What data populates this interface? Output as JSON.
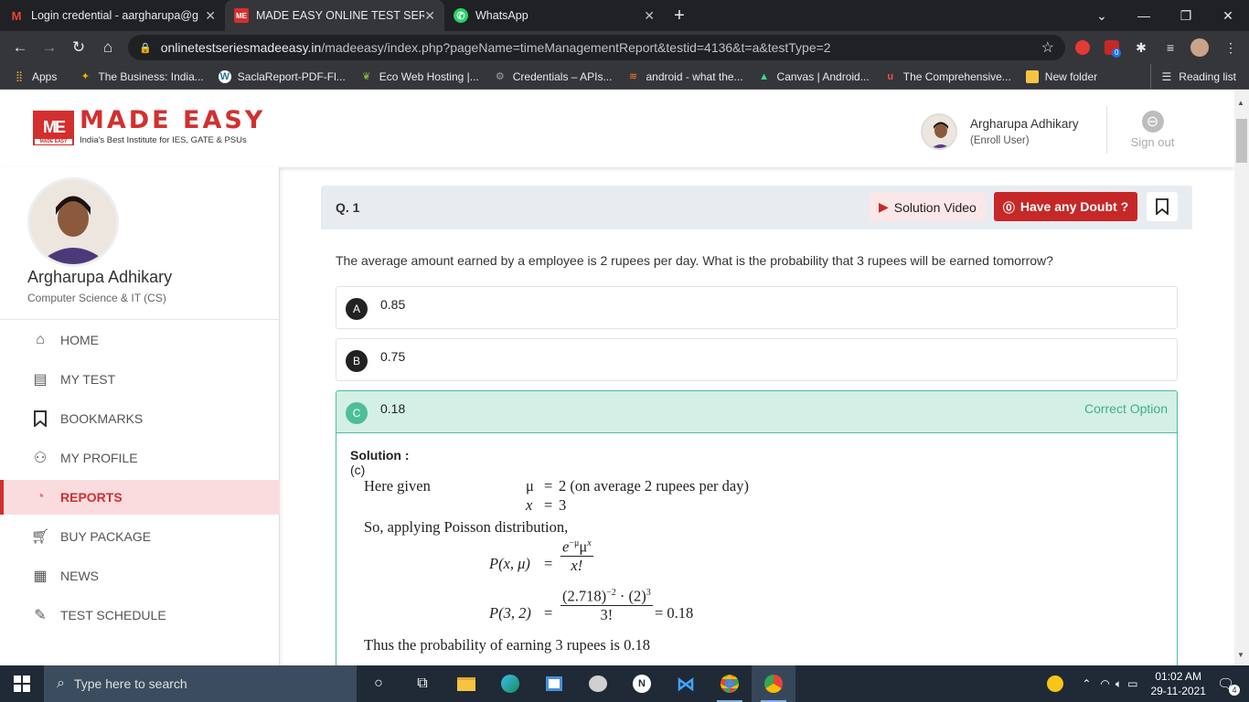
{
  "browser": {
    "tabs": [
      {
        "title": "Login credential - aargharupa@g",
        "icon": "gmail-icon"
      },
      {
        "title": "MADE EASY ONLINE TEST SERIES",
        "icon": "madeeasy-icon"
      },
      {
        "title": "WhatsApp",
        "icon": "whatsapp-icon"
      }
    ],
    "url_host": "onlinetestseriesmadeeasy.in",
    "url_path": "/madeeasy/index.php?pageName=timeManagementReport&testid=4136&t=a&testType=2",
    "ext_badge": "0",
    "bookmarks": [
      {
        "label": "Apps"
      },
      {
        "label": "The Business: India..."
      },
      {
        "label": "SaclaReport-PDF-Fl..."
      },
      {
        "label": "Eco Web Hosting |..."
      },
      {
        "label": "Credentials – APIs..."
      },
      {
        "label": "android - what the..."
      },
      {
        "label": "Canvas | Android..."
      },
      {
        "label": "The Comprehensive..."
      },
      {
        "label": "New folder"
      }
    ],
    "reading_list": "Reading list"
  },
  "header": {
    "logo_text": "MADE EASY",
    "logo_tagline": "India's Best Institute for IES, GATE & PSUs",
    "logo_box_sub": "MADE EASY",
    "user_name": "Argharupa Adhikary",
    "user_role": "(Enroll User)",
    "signout": "Sign out"
  },
  "sidebar": {
    "name": "Argharupa Adhikary",
    "dept": "Computer Science & IT (CS)",
    "items": [
      {
        "label": "HOME",
        "icon": "home-icon"
      },
      {
        "label": "MY TEST",
        "icon": "test-icon"
      },
      {
        "label": "BOOKMARKS",
        "icon": "bookmark-icon"
      },
      {
        "label": "MY PROFILE",
        "icon": "profile-icon"
      },
      {
        "label": "REPORTS",
        "icon": "reports-icon"
      },
      {
        "label": "BUY PACKAGE",
        "icon": "cart-icon"
      },
      {
        "label": "NEWS",
        "icon": "news-icon"
      },
      {
        "label": "TEST SCHEDULE",
        "icon": "schedule-icon"
      }
    ]
  },
  "question": {
    "number": "Q. 1",
    "solution_video": "Solution Video",
    "have_doubt": "Have any Doubt ?",
    "text": "The average amount earned by a employee is 2 rupees per day. What is the probability that 3 rupees will be earned tomorrow?",
    "options": [
      {
        "letter": "A",
        "value": "0.85"
      },
      {
        "letter": "B",
        "value": "0.75"
      },
      {
        "letter": "C",
        "value": "0.18"
      }
    ],
    "correct_label": "Correct Option",
    "solution_title": "Solution :",
    "solution_answer": "(c)",
    "sol_given": "Here given",
    "sol_mu": "μ",
    "sol_eq": "=",
    "sol_mu_val": "2 (on average 2 rupees per day)",
    "sol_x": "x",
    "sol_x_val": "3",
    "sol_applying": "So, applying Poisson distribution,",
    "sol_p1_lhs": "P(x, μ)",
    "sol_p1_num": "e",
    "sol_p1_num_sup": "−μ",
    "sol_p1_num_mu": "μ",
    "sol_p1_num_sup2": "x",
    "sol_p1_den": "x!",
    "sol_p2_lhs": "P(3, 2)",
    "sol_p2_num": "(2.718)",
    "sol_p2_sup1": "−2",
    "sol_p2_dot": " · (2)",
    "sol_p2_sup2": "3",
    "sol_p2_den": "3!",
    "sol_p2_res": "= 0.18",
    "sol_conclusion": "Thus the probability of earning 3 rupees is 0.18"
  },
  "taskbar": {
    "search_placeholder": "Type here to search",
    "time": "01:02 AM",
    "date": "29-11-2021",
    "notif_count": "4"
  },
  "colors": {
    "brand_red": "#d32f2f",
    "correct_green": "#4cbf99"
  }
}
